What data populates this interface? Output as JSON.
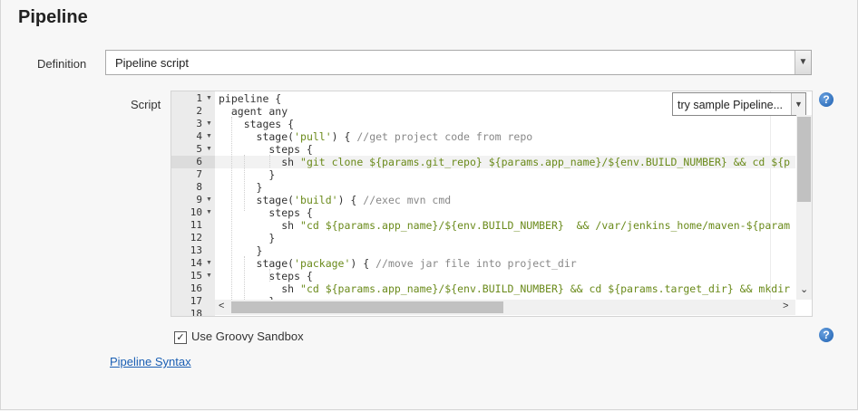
{
  "section": {
    "title": "Pipeline"
  },
  "definition": {
    "label": "Definition",
    "value": "Pipeline script"
  },
  "script": {
    "label": "Script",
    "sample_select": "try sample Pipeline...",
    "lines": [
      {
        "n": "1",
        "fold": true,
        "segs": [
          {
            "t": "pipeline {",
            "c": ""
          }
        ]
      },
      {
        "n": "2",
        "fold": false,
        "segs": [
          {
            "t": "  agent any",
            "c": ""
          }
        ]
      },
      {
        "n": "3",
        "fold": true,
        "segs": [
          {
            "t": "    stages {",
            "c": ""
          }
        ]
      },
      {
        "n": "4",
        "fold": true,
        "segs": [
          {
            "t": "      stage(",
            "c": ""
          },
          {
            "t": "'pull'",
            "c": "str"
          },
          {
            "t": ") { ",
            "c": ""
          },
          {
            "t": "//get project code from repo",
            "c": "cmt"
          }
        ]
      },
      {
        "n": "5",
        "fold": true,
        "segs": [
          {
            "t": "        steps {",
            "c": ""
          }
        ]
      },
      {
        "n": "6",
        "fold": false,
        "segs": [
          {
            "t": "          sh ",
            "c": ""
          },
          {
            "t": "\"git clone ${params.git_repo} ${params.app_name}/${env.BUILD_NUMBER} && cd ${p",
            "c": "str"
          }
        ]
      },
      {
        "n": "7",
        "fold": false,
        "segs": [
          {
            "t": "        }",
            "c": ""
          }
        ]
      },
      {
        "n": "8",
        "fold": false,
        "segs": [
          {
            "t": "      }",
            "c": ""
          }
        ]
      },
      {
        "n": "9",
        "fold": true,
        "segs": [
          {
            "t": "      stage(",
            "c": ""
          },
          {
            "t": "'build'",
            "c": "str"
          },
          {
            "t": ") { ",
            "c": ""
          },
          {
            "t": "//exec mvn cmd",
            "c": "cmt"
          }
        ]
      },
      {
        "n": "10",
        "fold": true,
        "segs": [
          {
            "t": "        steps {",
            "c": ""
          }
        ]
      },
      {
        "n": "11",
        "fold": false,
        "segs": [
          {
            "t": "          sh ",
            "c": ""
          },
          {
            "t": "\"cd ${params.app_name}/${env.BUILD_NUMBER}  && /var/jenkins_home/maven-${param",
            "c": "str"
          }
        ]
      },
      {
        "n": "12",
        "fold": false,
        "segs": [
          {
            "t": "        }",
            "c": ""
          }
        ]
      },
      {
        "n": "13",
        "fold": false,
        "segs": [
          {
            "t": "      }",
            "c": ""
          }
        ]
      },
      {
        "n": "14",
        "fold": true,
        "segs": [
          {
            "t": "      stage(",
            "c": ""
          },
          {
            "t": "'package'",
            "c": "str"
          },
          {
            "t": ") { ",
            "c": ""
          },
          {
            "t": "//move jar file into project_dir",
            "c": "cmt"
          }
        ]
      },
      {
        "n": "15",
        "fold": true,
        "segs": [
          {
            "t": "        steps {",
            "c": ""
          }
        ]
      },
      {
        "n": "16",
        "fold": false,
        "segs": [
          {
            "t": "          sh ",
            "c": ""
          },
          {
            "t": "\"cd ${params.app_name}/${env.BUILD_NUMBER} && cd ${params.target_dir} && mkdir",
            "c": "str"
          }
        ]
      },
      {
        "n": "17",
        "fold": false,
        "segs": [
          {
            "t": "        }",
            "c": ""
          }
        ]
      },
      {
        "n": "18",
        "fold": false,
        "segs": []
      }
    ],
    "current_line": 6
  },
  "sandbox": {
    "label": "Use Groovy Sandbox",
    "checked": true
  },
  "syntax_link": "Pipeline Syntax",
  "icons": {
    "help": "help-icon",
    "dropdown": "chevron-down-icon",
    "check": "checkmark-icon"
  }
}
